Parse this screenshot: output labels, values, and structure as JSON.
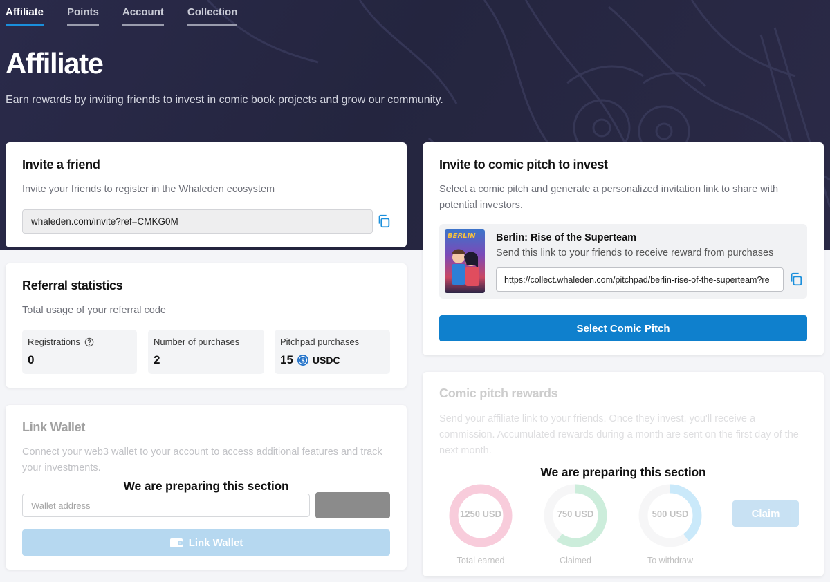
{
  "tabs": [
    {
      "label": "Affiliate",
      "active": true
    },
    {
      "label": "Points",
      "active": false
    },
    {
      "label": "Account",
      "active": false
    },
    {
      "label": "Collection",
      "active": false
    }
  ],
  "hero": {
    "title": "Affiliate",
    "subtitle": "Earn rewards by inviting friends to invest in comic book projects and grow our community."
  },
  "invite_friend": {
    "title": "Invite a friend",
    "description": "Invite your friends to register in the Whaleden ecosystem",
    "link": "whaleden.com/invite?ref=CMKG0M",
    "copy_icon": "copy-icon"
  },
  "referral": {
    "title": "Referral statistics",
    "description": "Total usage of your referral code",
    "registrations_label": "Registrations",
    "registrations_value": "0",
    "purchases_label": "Number of purchases",
    "purchases_value": "2",
    "pitchpad_label": "Pitchpad purchases",
    "pitchpad_value": "15",
    "pitchpad_unit": "USDC"
  },
  "link_wallet": {
    "title": "Link Wallet",
    "description": "Connect your web3 wallet to your account to access additional features and track your investments.",
    "overlay": "We are preparing this section",
    "input_placeholder": "Wallet address",
    "button_label": "Link Wallet"
  },
  "pitch_invite": {
    "title": "Invite to comic pitch to invest",
    "description": "Select a comic pitch and generate a personalized invitation link to share with potential investors.",
    "pitch_title": "Berlin: Rise of the Superteam",
    "cover_text": "BERLIN",
    "pitch_desc": "Send this link to your friends to receive reward from purchases",
    "pitch_link": "https://collect.whaleden.com/pitchpad/berlin-rise-of-the-superteam?re",
    "button_label": "Select Comic Pitch"
  },
  "rewards": {
    "title": "Comic pitch rewards",
    "description": "Send your affiliate link to your friends. Once they invest, you'll receive a commission. Accumulated rewards during a month are sent on the first day of the next month.",
    "overlay": "We are preparing this section",
    "total_value": "1250 USD",
    "total_label": "Total earned",
    "claimed_value": "750 USD",
    "claimed_label": "Claimed",
    "withdraw_value": "500 USD",
    "withdraw_label": "To withdraw",
    "claim_label": "Claim"
  },
  "colors": {
    "accent": "#0f80cd",
    "hero_bg": "#24253f",
    "total_ring": "#f08fb0",
    "claimed_ring": "#8fd8b0",
    "withdraw_ring": "#8ccff5"
  }
}
